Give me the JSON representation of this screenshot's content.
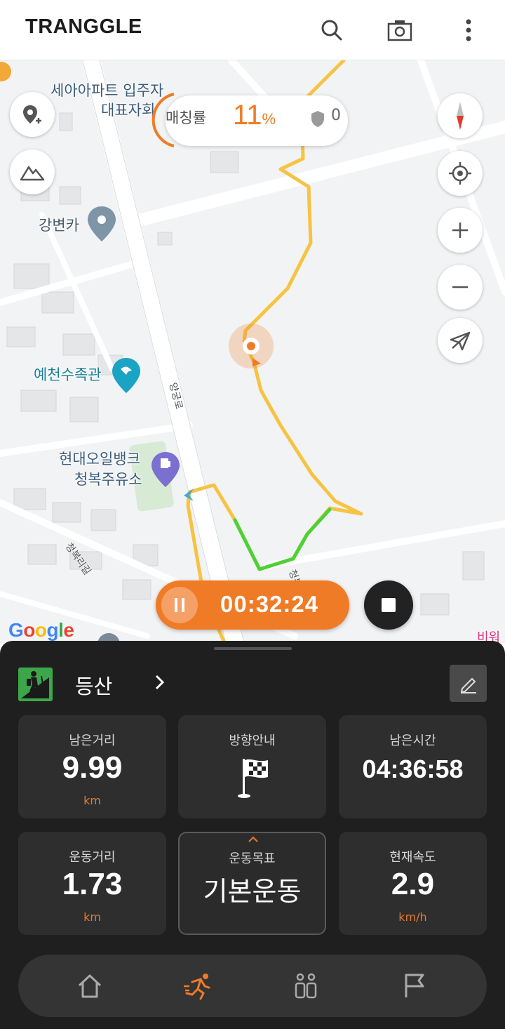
{
  "header": {
    "logo": "TRANGGLE",
    "icons": [
      "search-icon",
      "camera-icon",
      "more-vertical-icon"
    ]
  },
  "map": {
    "labels": {
      "apartment": "세아아파트 입주자",
      "apartment2": "대표자회",
      "gangbyeonka": "강변카",
      "aquarium": "예천수족관",
      "gas1": "현대오일뱅크",
      "gas2": "청복주유소",
      "road1": "양궁로",
      "road2": "청복리길",
      "road3": "청복",
      "edge": "비워"
    },
    "matching": {
      "label": "매칭률",
      "value": "11",
      "unit": "%",
      "shield_count": "0"
    },
    "timer": "00:32:24",
    "attribution": [
      "G",
      "o",
      "o",
      "g",
      "l",
      "e"
    ]
  },
  "activity": {
    "name": "등산"
  },
  "stats": {
    "remaining_distance": {
      "title": "남은거리",
      "value": "9.99",
      "unit": "km"
    },
    "direction_guide": {
      "title": "방향안내"
    },
    "remaining_time": {
      "title": "남은시간",
      "value": "04:36:58"
    },
    "exercise_distance": {
      "title": "운동거리",
      "value": "1.73",
      "unit": "km"
    },
    "exercise_goal": {
      "title": "운동목표",
      "value": "기본운동"
    },
    "current_speed": {
      "title": "현재속도",
      "value": "2.9",
      "unit": "km/h"
    }
  },
  "colors": {
    "accent": "#f07b26",
    "route": "#f6c343",
    "route_done": "#4cd137",
    "panel": "#1f1f1f"
  },
  "nav": [
    "home-icon",
    "exercise-icon",
    "people-icon",
    "flag-icon"
  ]
}
